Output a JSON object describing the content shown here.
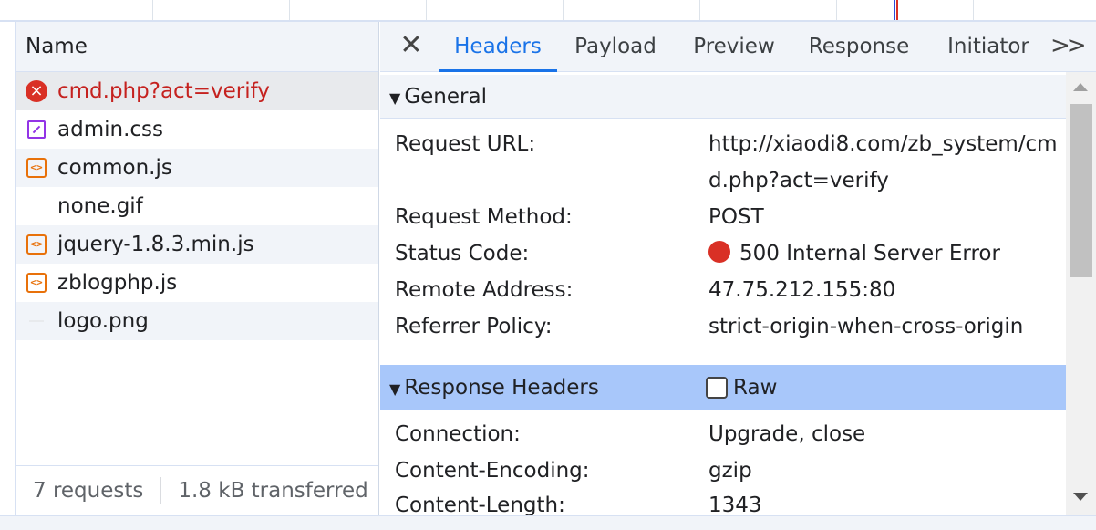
{
  "requests": {
    "column_header": "Name",
    "items": [
      {
        "name": "cmd.php?act=verify",
        "icon": "error-icon",
        "status": "error"
      },
      {
        "name": "admin.css",
        "icon": "stylesheet-icon"
      },
      {
        "name": "common.js",
        "icon": "script-icon"
      },
      {
        "name": "none.gif",
        "icon": "none"
      },
      {
        "name": "jquery-1.8.3.min.js",
        "icon": "script-icon"
      },
      {
        "name": "zblogphp.js",
        "icon": "script-icon"
      },
      {
        "name": "logo.png",
        "icon": "image-icon"
      }
    ],
    "footer": {
      "count": "7 requests",
      "transferred": "1.8 kB transferred"
    }
  },
  "tabs": {
    "close_icon": "close-icon",
    "items": [
      "Headers",
      "Payload",
      "Preview",
      "Response",
      "Initiator"
    ],
    "active": "Headers",
    "more_icon": "chevron-double-right-icon"
  },
  "general": {
    "title": "General",
    "request_url_label": "Request URL:",
    "request_url_line1": "http://xiaodi8.com/zb_system/cm",
    "request_url_line2": "d.php?act=verify",
    "request_method_label": "Request Method:",
    "request_method": "POST",
    "status_code_label": "Status Code:",
    "status_code": "500 Internal Server Error",
    "remote_address_label": "Remote Address:",
    "remote_address": "47.75.212.155:80",
    "referrer_policy_label": "Referrer Policy:",
    "referrer_policy": "strict-origin-when-cross-origin"
  },
  "response_headers": {
    "title": "Response Headers",
    "raw_label": "Raw",
    "raw_checked": false,
    "rows": [
      {
        "key": "Connection:",
        "value": "Upgrade, close"
      },
      {
        "key": "Content-Encoding:",
        "value": "gzip"
      },
      {
        "key": "Content-Length:",
        "value": "1343"
      }
    ]
  },
  "colors": {
    "accent": "#1a73e8",
    "error": "#d93025",
    "selected_section": "#a8c7fa"
  }
}
